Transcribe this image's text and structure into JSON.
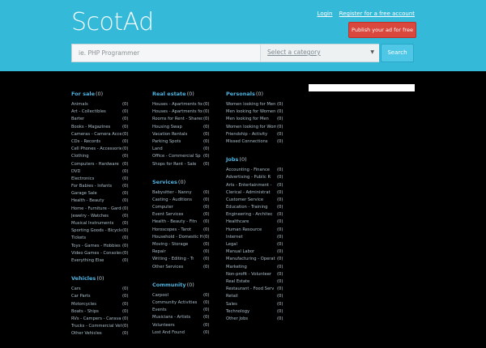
{
  "header": {
    "logo": "ScotAd",
    "login_label": "Login",
    "register_label": "Register for a free account",
    "publish_label": "Publish your ad for free"
  },
  "search": {
    "placeholder": "ie. PHP Programmer",
    "category_label": "Select a category",
    "button_label": "Search"
  },
  "colors": {
    "header_bg": "#35b9d9",
    "body_bg": "#000000",
    "publish_btn": "#d9473d",
    "search_btn": "#4ec6e6",
    "section_title": "#4fb3e0"
  },
  "columns": [
    [
      {
        "title": "For sale",
        "count": "(0)",
        "items": [
          {
            "name": "Animals",
            "count": "(0)"
          },
          {
            "name": "Art - Collectibles",
            "count": "(0)"
          },
          {
            "name": "Barter",
            "count": "(0)"
          },
          {
            "name": "Books - Magazines",
            "count": "(0)"
          },
          {
            "name": "Cameras - Camera Accessor",
            "count": "(0)"
          },
          {
            "name": "CDs - Records",
            "count": "(0)"
          },
          {
            "name": "Cell Phones - Accessories",
            "count": "(0)"
          },
          {
            "name": "Clothing",
            "count": "(0)"
          },
          {
            "name": "Computers - Hardware",
            "count": "(0)"
          },
          {
            "name": "DVD",
            "count": "(0)"
          },
          {
            "name": "Electronics",
            "count": "(0)"
          },
          {
            "name": "For Babies - Infants",
            "count": "(0)"
          },
          {
            "name": "Garage Sale",
            "count": "(0)"
          },
          {
            "name": "Health - Beauty",
            "count": "(0)"
          },
          {
            "name": "Home - Furniture - Garden",
            "count": "(0)"
          },
          {
            "name": "Jewelry - Watches",
            "count": "(0)"
          },
          {
            "name": "Musical Instruments",
            "count": "(0)"
          },
          {
            "name": "Sporting Goods - Bicycles",
            "count": "(0)"
          },
          {
            "name": "Tickets",
            "count": "(0)"
          },
          {
            "name": "Toys - Games - Hobbies",
            "count": "(0)"
          },
          {
            "name": "Video Games - Consoles",
            "count": "(0)"
          },
          {
            "name": "Everything Else",
            "count": "(0)"
          }
        ]
      },
      {
        "title": "Vehicles",
        "count": "(0)",
        "items": [
          {
            "name": "Cars",
            "count": "(0)"
          },
          {
            "name": "Car Parts",
            "count": "(0)"
          },
          {
            "name": "Motorcycles",
            "count": "(0)"
          },
          {
            "name": "Boats - Ships",
            "count": "(0)"
          },
          {
            "name": "RVs - Campers - Caravans",
            "count": "(0)"
          },
          {
            "name": "Trucks - Commercial Vehic",
            "count": "(0)"
          },
          {
            "name": "Other Vehicles",
            "count": "(0)"
          }
        ]
      }
    ],
    [
      {
        "title": "Real estate",
        "count": "(0)",
        "items": [
          {
            "name": "Houses - Apartments for",
            "count": "(0)"
          },
          {
            "name": "Houses - Apartments for",
            "count": "(0)"
          },
          {
            "name": "Rooms for Rent - Shared",
            "count": "(0)"
          },
          {
            "name": "Housing Swap",
            "count": "(0)"
          },
          {
            "name": "Vacation Rentals",
            "count": "(0)"
          },
          {
            "name": "Parking Spots",
            "count": "(0)"
          },
          {
            "name": "Land",
            "count": "(0)"
          },
          {
            "name": "Office - Commercial Sp",
            "count": "(0)"
          },
          {
            "name": "Shops for Rent - Sale",
            "count": "(0)"
          }
        ]
      },
      {
        "title": "Services",
        "count": "(0)",
        "items": [
          {
            "name": "Babysitter - Nanny",
            "count": "(0)"
          },
          {
            "name": "Casting - Auditions",
            "count": "(0)"
          },
          {
            "name": "Computer",
            "count": "(0)"
          },
          {
            "name": "Event Services",
            "count": "(0)"
          },
          {
            "name": "Health - Beauty - Fitn",
            "count": "(0)"
          },
          {
            "name": "Horoscopes - Tarot",
            "count": "(0)"
          },
          {
            "name": "Household - Domestic H",
            "count": "(0)"
          },
          {
            "name": "Moving - Storage",
            "count": "(0)"
          },
          {
            "name": "Repair",
            "count": "(0)"
          },
          {
            "name": "Writing - Editing - Tr",
            "count": "(0)"
          },
          {
            "name": "Other Services",
            "count": "(0)"
          }
        ]
      },
      {
        "title": "Community",
        "count": "(0)",
        "items": [
          {
            "name": "Carpool",
            "count": "(0)"
          },
          {
            "name": "Community Activities",
            "count": "(0)"
          },
          {
            "name": "Events",
            "count": "(0)"
          },
          {
            "name": "Musicians - Artists",
            "count": "(0)"
          },
          {
            "name": "Volunteers",
            "count": "(0)"
          },
          {
            "name": "Lost And Found",
            "count": "(0)"
          }
        ]
      }
    ],
    [
      {
        "title": "Personals",
        "count": "(0)",
        "items": [
          {
            "name": "Women looking for Men",
            "count": "(0)"
          },
          {
            "name": "Men looking for Women",
            "count": "(0)"
          },
          {
            "name": "Men looking for Men",
            "count": "(0)"
          },
          {
            "name": "Women looking for Wome",
            "count": "(0)"
          },
          {
            "name": "Friendship - Activity",
            "count": "(0)"
          },
          {
            "name": "Missed Connections",
            "count": "(0)"
          }
        ]
      },
      {
        "title": "Jobs",
        "count": "(0)",
        "items": [
          {
            "name": "Accounting - Finance",
            "count": "(0)"
          },
          {
            "name": "Advertising - Public R",
            "count": "(0)"
          },
          {
            "name": "Arts - Entertainment -",
            "count": "(0)"
          },
          {
            "name": "Clerical - Administrat",
            "count": "(0)"
          },
          {
            "name": "Customer Service",
            "count": "(0)"
          },
          {
            "name": "Education - Training",
            "count": "(0)"
          },
          {
            "name": "Engineering - Architec",
            "count": "(0)"
          },
          {
            "name": "Healthcare",
            "count": "(0)"
          },
          {
            "name": "Human Resource",
            "count": "(0)"
          },
          {
            "name": "Internet",
            "count": "(0)"
          },
          {
            "name": "Legal",
            "count": "(0)"
          },
          {
            "name": "Manual Labor",
            "count": "(0)"
          },
          {
            "name": "Manufacturing - Operat",
            "count": "(0)"
          },
          {
            "name": "Marketing",
            "count": "(0)"
          },
          {
            "name": "Non-profit - Volunteer",
            "count": "(0)"
          },
          {
            "name": "Real Estate",
            "count": "(0)"
          },
          {
            "name": "Restaurant - Food Serv",
            "count": "(0)"
          },
          {
            "name": "Retail",
            "count": "(0)"
          },
          {
            "name": "Sales",
            "count": "(0)"
          },
          {
            "name": "Technology",
            "count": "(0)"
          },
          {
            "name": "Other Jobs",
            "count": "(0)"
          }
        ]
      }
    ]
  ]
}
